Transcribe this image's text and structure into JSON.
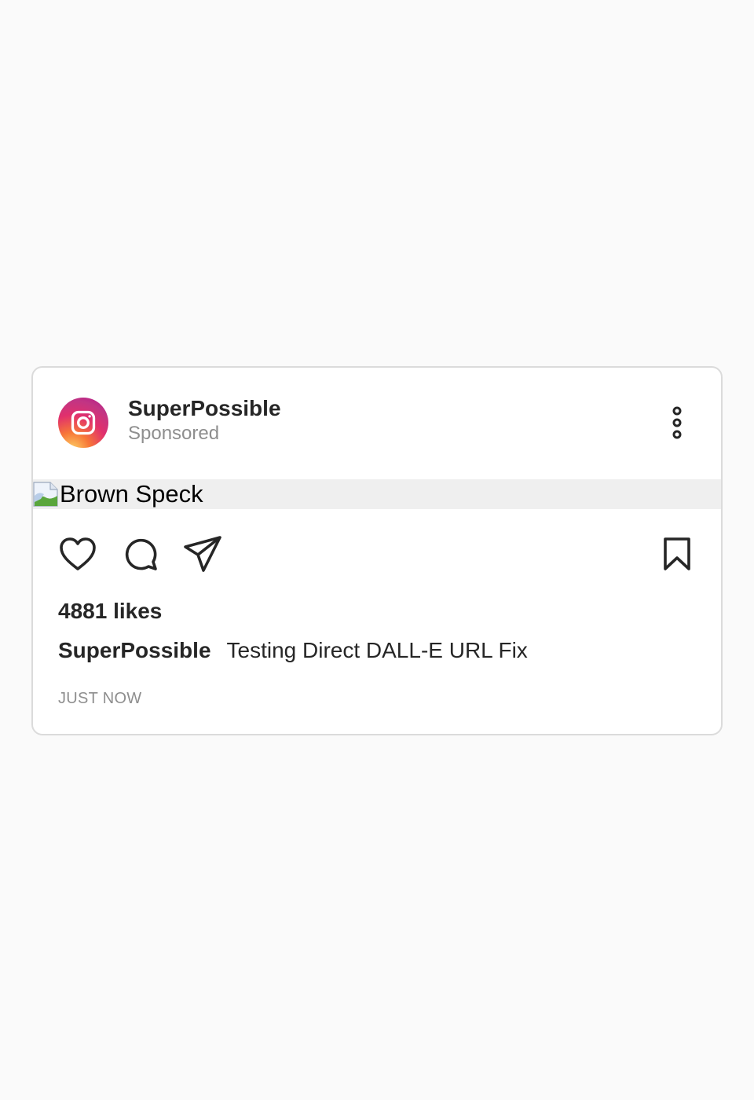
{
  "post": {
    "username": "SuperPossible",
    "sponsored_label": "Sponsored",
    "image_alt": "Brown Speck",
    "likes_text": "4881 likes",
    "caption_user": "SuperPossible",
    "caption_text": "Testing Direct DALL-E URL Fix",
    "timestamp": "JUST NOW"
  },
  "icons": {
    "avatar": "instagram-logo-icon",
    "more": "more-vertical-icon",
    "like": "heart-icon",
    "comment": "comment-icon",
    "share": "paper-plane-icon",
    "save": "bookmark-icon",
    "broken_image": "broken-image-icon"
  },
  "colors": {
    "background": "#fafafa",
    "card": "#ffffff",
    "border": "#dbdbdb",
    "text": "#262626",
    "muted": "#8e8e8e",
    "media_placeholder": "#efefef"
  }
}
